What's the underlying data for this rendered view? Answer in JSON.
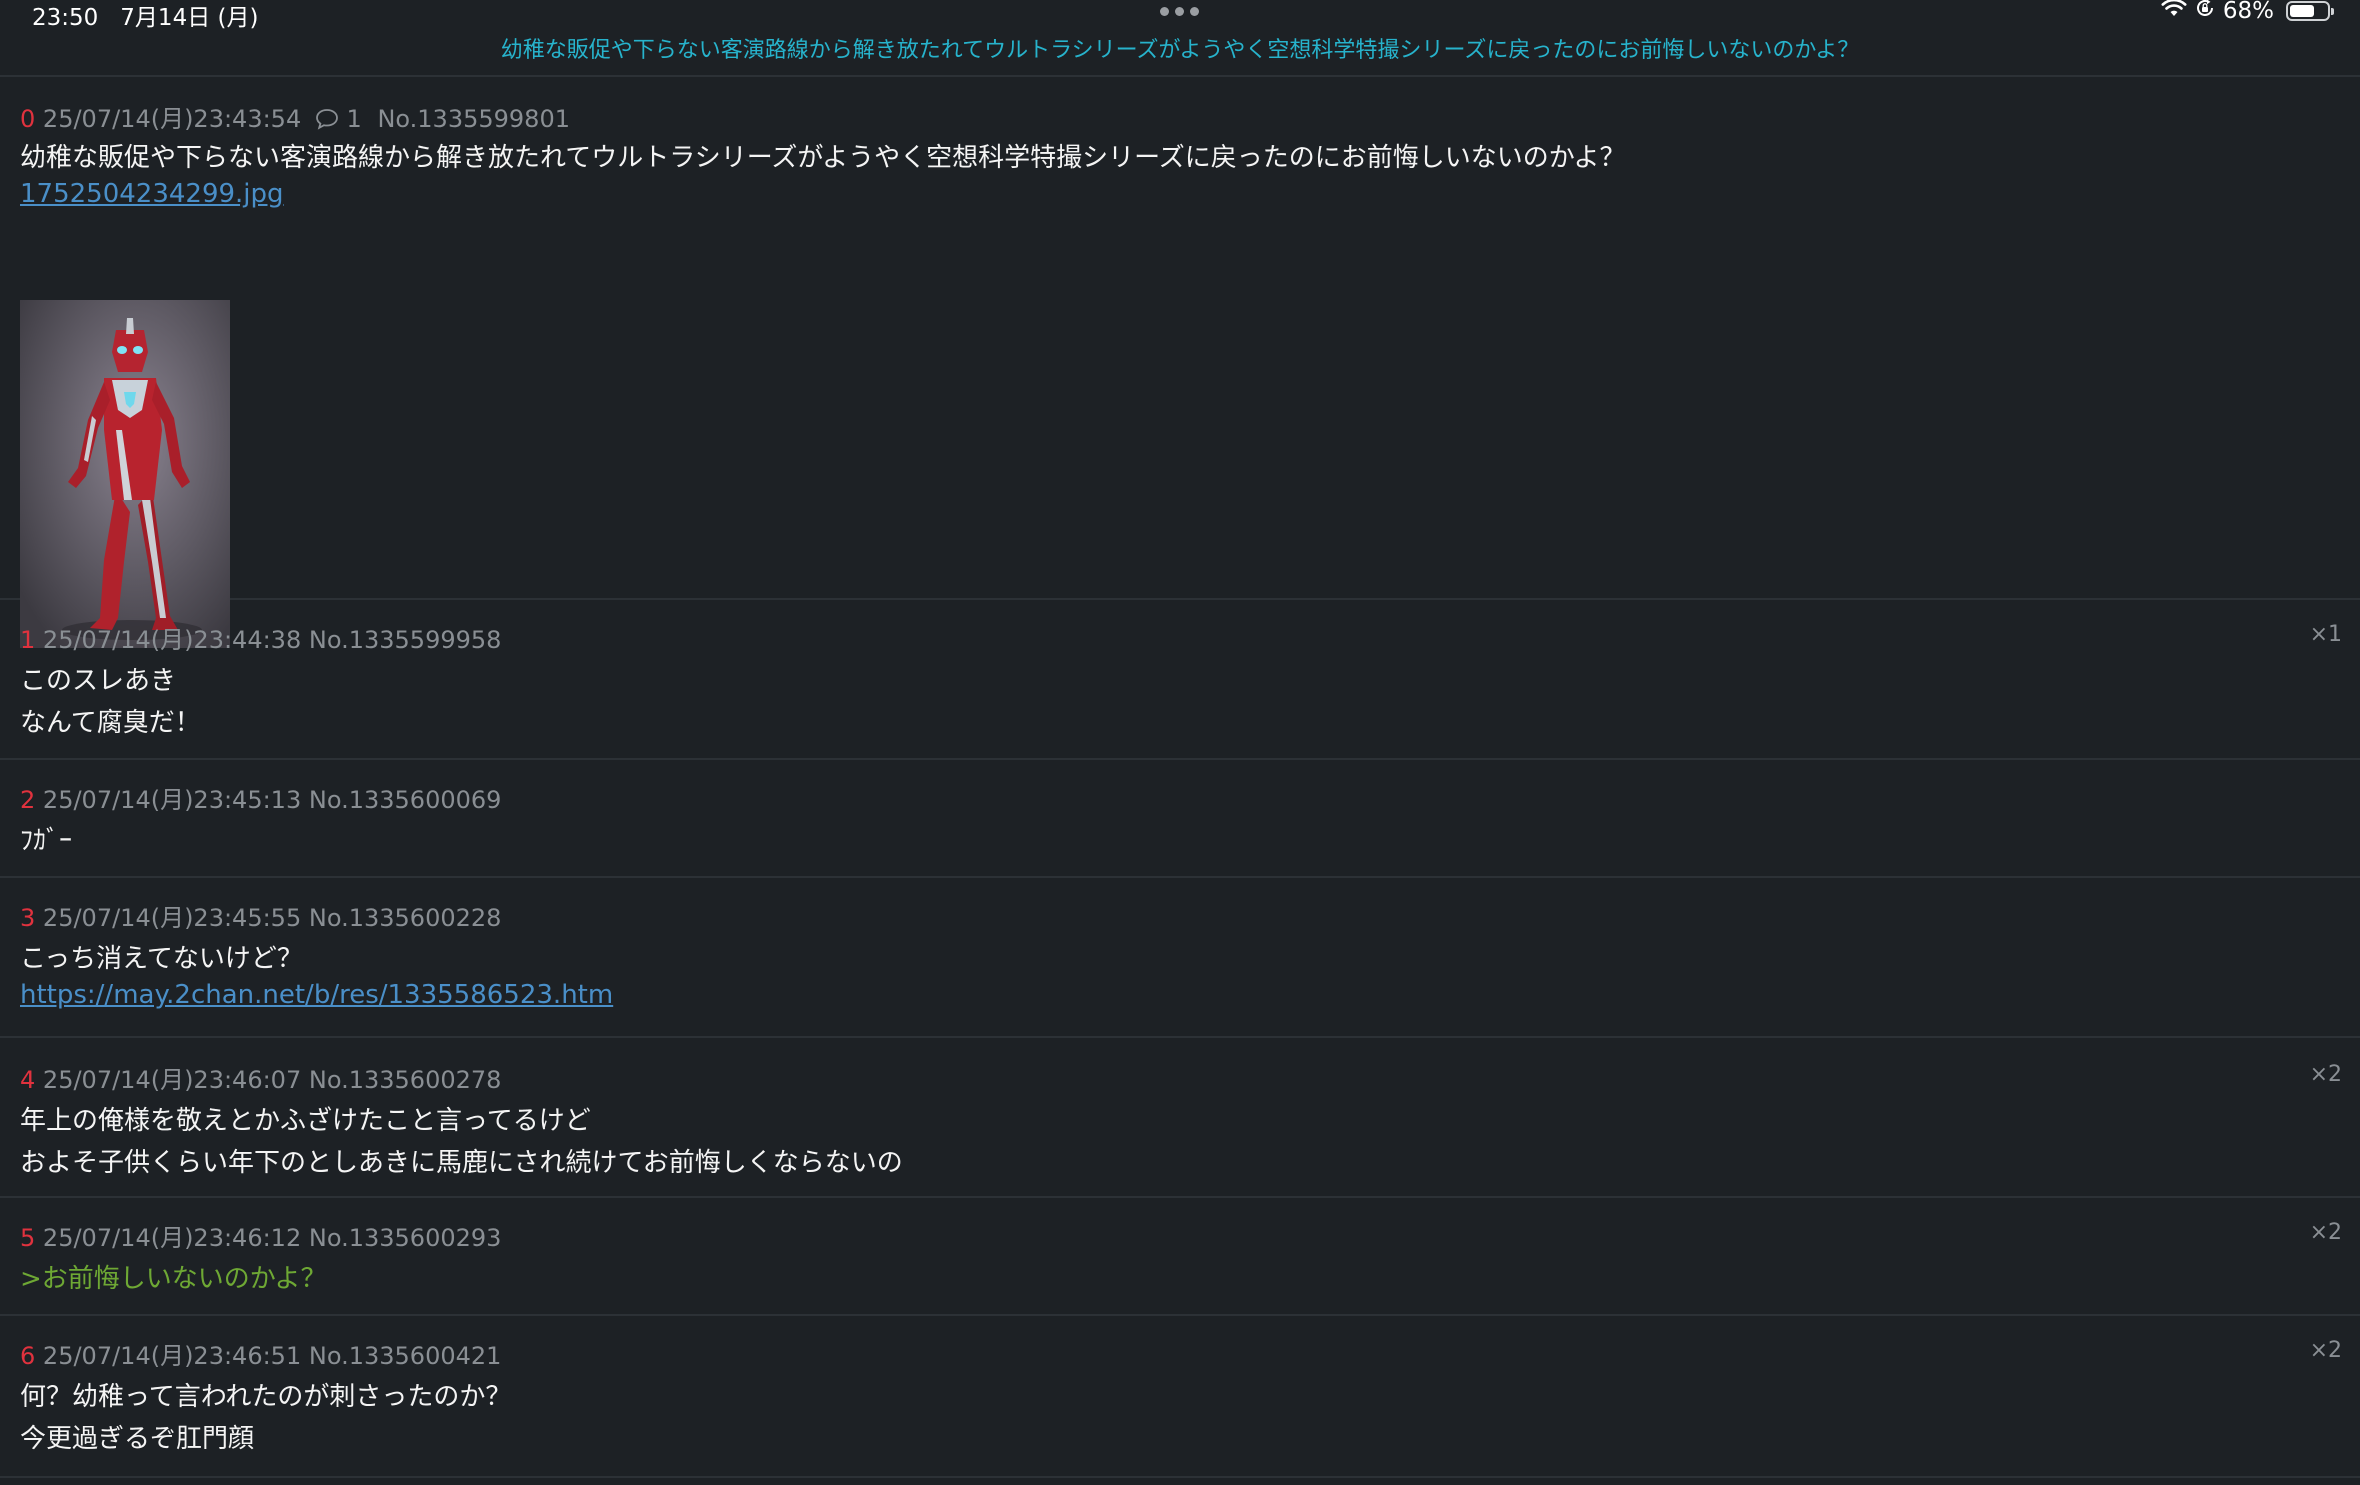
{
  "status_bar": {
    "time": "23:50",
    "date": "7月14日 (月)",
    "battery_percent": "68%",
    "battery_level": 0.68,
    "icons": [
      "wifi-icon",
      "orientation-lock-icon",
      "battery-icon"
    ]
  },
  "thread": {
    "title": "幼稚な販促や下らない客演路線から解き放たれてウルトラシリーズがようやく空想科学特撮シリーズに戻ったのにお前悔しいないのかよ？"
  },
  "posts": [
    {
      "num": "0",
      "datetime": "25/07/14(月)23:43:54",
      "comments": "1",
      "no": "No.1335599801",
      "lines": [
        "幼稚な販促や下らない客演路線から解き放たれてウルトラシリーズがようやく空想科学特撮シリーズに戻ったのにお前悔しいないのかよ？"
      ],
      "file": "1752504234299.jpg",
      "thumbnail": "red-silver-hero-figure-image"
    },
    {
      "num": "1",
      "datetime": "25/07/14(月)23:44:38",
      "no": "No.1335599958",
      "replies": "×1",
      "lines": [
        "このスレあき",
        "なんて腐臭だ！"
      ]
    },
    {
      "num": "2",
      "datetime": "25/07/14(月)23:45:13",
      "no": "No.1335600069",
      "lines": [
        "ﾌｶﾞｰ"
      ]
    },
    {
      "num": "3",
      "datetime": "25/07/14(月)23:45:55",
      "no": "No.1335600228",
      "lines": [
        "こっち消えてないけど？"
      ],
      "link": "https://may.2chan.net/b/res/1335586523.htm"
    },
    {
      "num": "4",
      "datetime": "25/07/14(月)23:46:07",
      "no": "No.1335600278",
      "replies": "×2",
      "lines": [
        "年上の俺様を敬えとかふざけたこと言ってるけど",
        "およそ子供くらい年下のとしあきに馬鹿にされ続けてお前悔しくならないの"
      ]
    },
    {
      "num": "5",
      "datetime": "25/07/14(月)23:46:12",
      "no": "No.1335600293",
      "replies": "×2",
      "quote": ">お前悔しいないのかよ？"
    },
    {
      "num": "6",
      "datetime": "25/07/14(月)23:46:51",
      "no": "No.1335600421",
      "replies": "×2",
      "lines": [
        "何？幼稚って言われたのが刺さったのか？",
        "今更過ぎるぞ肛門顔"
      ]
    }
  ],
  "colors": {
    "background": "#1d2125",
    "title_accent": "#27b3cc",
    "post_number": "#e0323e",
    "meta_text": "#8a8f94",
    "link": "#4a8fc8",
    "quote": "#6ea834"
  }
}
